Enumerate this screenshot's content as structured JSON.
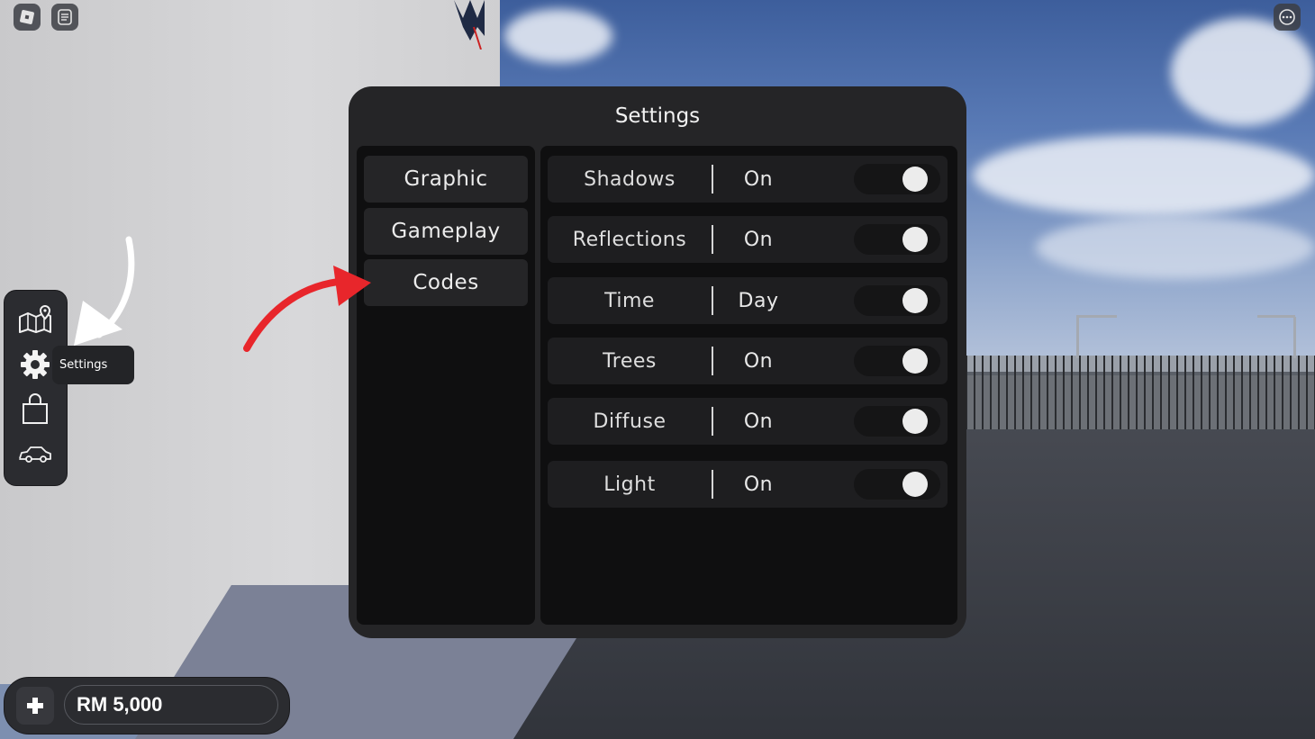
{
  "settings_panel": {
    "title": "Settings",
    "tabs": [
      {
        "label": "Graphic"
      },
      {
        "label": "Gameplay"
      },
      {
        "label": "Codes"
      }
    ],
    "options": [
      {
        "label": "Shadows",
        "value": "On",
        "enabled": true
      },
      {
        "label": "Reflections",
        "value": "On",
        "enabled": true
      },
      {
        "label": "Time",
        "value": "Day",
        "enabled": true
      },
      {
        "label": "Trees",
        "value": "On",
        "enabled": true
      },
      {
        "label": "Diffuse",
        "value": "On",
        "enabled": true
      },
      {
        "label": "Light",
        "value": "On",
        "enabled": true
      }
    ]
  },
  "side_menu": {
    "items": [
      {
        "icon": "map-icon"
      },
      {
        "icon": "gear-icon"
      },
      {
        "icon": "shopping-bag-icon"
      },
      {
        "icon": "car-icon"
      }
    ],
    "tooltip": "Settings"
  },
  "currency": {
    "balance": "RM 5,000",
    "add_icon": "plus-icon"
  },
  "top_bar": {
    "left_icons": [
      "roblox-menu-icon",
      "chat-icon"
    ],
    "right_icon": "more-options-icon"
  },
  "annotations": {
    "arrow_color_red": "#e8262b",
    "arrow_color_white": "#ffffff"
  }
}
